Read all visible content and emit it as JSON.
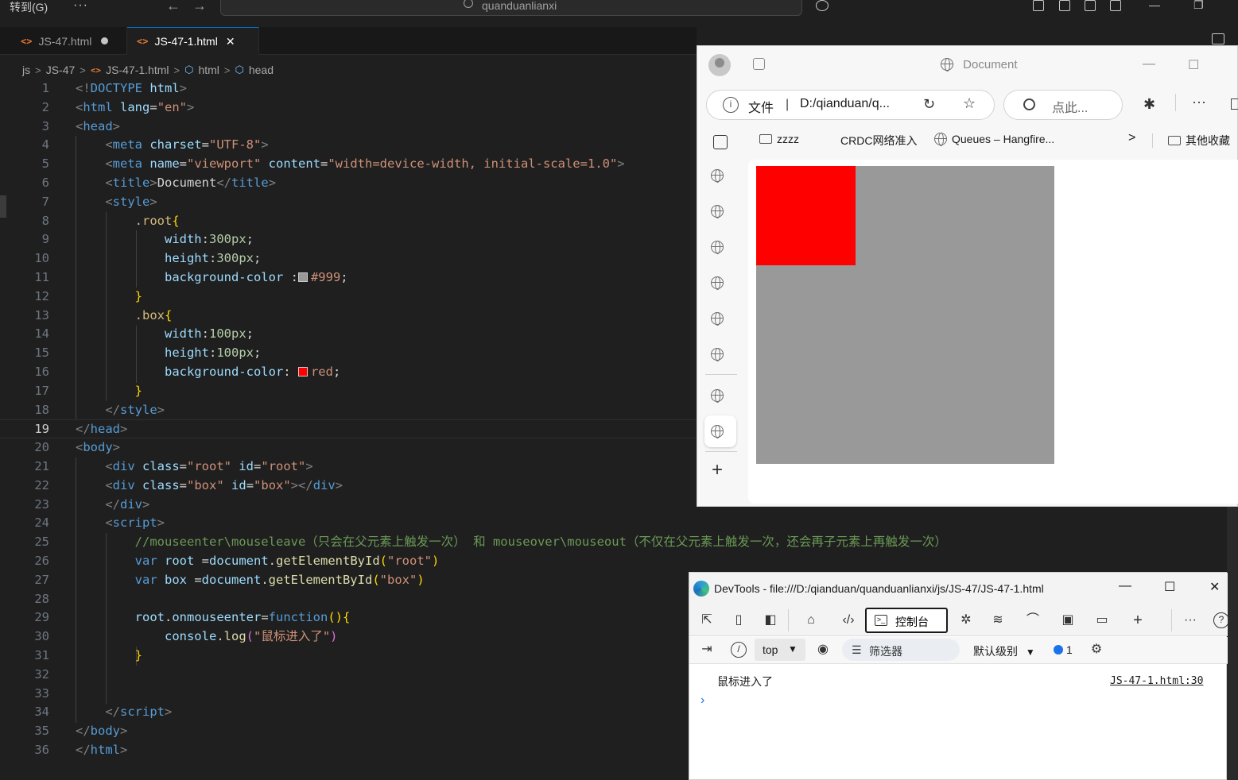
{
  "titlebar": {
    "goto_label": "转到(G)",
    "more_label": "···",
    "back_icon": "←",
    "forward_icon": "→",
    "search_text": "quanduanlianxi",
    "minimize": "—",
    "restore": "❐"
  },
  "tabs": [
    {
      "label": "JS-47.html",
      "icon": "<>",
      "modified": true,
      "active": false
    },
    {
      "label": "JS-47-1.html",
      "icon": "<>",
      "close": "✕",
      "active": true
    }
  ],
  "breadcrumb": {
    "parts": [
      "js",
      "JS-47",
      "JS-47-1.html",
      "html",
      "head"
    ],
    "sep": ">"
  },
  "editor": {
    "current_line": 19,
    "swatch_colors": {
      "gray": "#999999",
      "red": "#ff0000"
    },
    "lines": [
      "1",
      "2",
      "3",
      "4",
      "5",
      "6",
      "7",
      "8",
      "9",
      "10",
      "11",
      "12",
      "13",
      "14",
      "15",
      "16",
      "17",
      "18",
      "19",
      "20",
      "21",
      "22",
      "23",
      "24",
      "25",
      "26",
      "27",
      "28",
      "29",
      "30",
      "31",
      "32",
      "33",
      "34",
      "35",
      "36"
    ],
    "code": {
      "l1a": "<!",
      "l1b": "DOCTYPE",
      "l1c": " html",
      "l1d": ">",
      "l2a": "<",
      "l2b": "html",
      "l2c": " lang",
      "l2d": "=",
      "l2e": "\"en\"",
      "l2f": ">",
      "l3a": "<",
      "l3b": "head",
      "l3c": ">",
      "l4a": "<",
      "l4b": "meta",
      "l4c": " charset",
      "l4d": "=",
      "l4e": "\"UTF-8\"",
      "l4f": ">",
      "l5a": "<",
      "l5b": "meta",
      "l5c": " name",
      "l5d": "=",
      "l5e": "\"viewport\"",
      "l5f": " content",
      "l5g": "=",
      "l5h": "\"width=device-width, initial-scale=1.0\"",
      "l5i": ">",
      "l6a": "<",
      "l6b": "title",
      "l6c": ">",
      "l6d": "Document",
      "l6e": "</",
      "l6f": "title",
      "l6g": ">",
      "l7a": "<",
      "l7b": "style",
      "l7c": ">",
      "l8a": ".root",
      "l8b": "{",
      "l9a": "width",
      "l9b": ":",
      "l9c": "300px",
      "l9d": ";",
      "l10a": "height",
      "l10b": ":",
      "l10c": "300px",
      "l10d": ";",
      "l11a": "background-color",
      "l11b": " :",
      "l11c": "#999",
      "l11d": ";",
      "l12a": "}",
      "l13a": ".box",
      "l13b": "{",
      "l14a": "width",
      "l14b": ":",
      "l14c": "100px",
      "l14d": ";",
      "l15a": "height",
      "l15b": ":",
      "l15c": "100px",
      "l15d": ";",
      "l16a": "background-color",
      "l16b": ": ",
      "l16c": "red",
      "l16d": ";",
      "l17a": "}",
      "l18a": "</",
      "l18b": "style",
      "l18c": ">",
      "l19a": "</",
      "l19b": "head",
      "l19c": ">",
      "l20a": "<",
      "l20b": "body",
      "l20c": ">",
      "l21a": "<",
      "l21b": "div",
      "l21c": " class",
      "l21d": "=",
      "l21e": "\"root\"",
      "l21f": " id",
      "l21g": "=",
      "l21h": "\"root\"",
      "l21i": ">",
      "l22a": "<",
      "l22b": "div",
      "l22c": " class",
      "l22d": "=",
      "l22e": "\"box\"",
      "l22f": " id",
      "l22g": "=",
      "l22h": "\"box\"",
      "l22i": "></",
      "l22j": "div",
      "l22k": ">",
      "l23a": "</",
      "l23b": "div",
      "l23c": ">",
      "l24a": "<",
      "l24b": "script",
      "l24c": ">",
      "l25a": "//mouseenter\\mouseleave（只会在父元素上触发一次） 和 mouseover\\mouseout（不仅在父元素上触发一次，还会再子元素上再触发一次）",
      "l26a": "var",
      "l26b": " root",
      "l26c": " =",
      "l26d": "document",
      "l26e": ".",
      "l26f": "getElementById",
      "l26g": "(",
      "l26h": "\"root\"",
      "l26i": ")",
      "l27a": "var",
      "l27b": " box",
      "l27c": " =",
      "l27d": "document",
      "l27e": ".",
      "l27f": "getElementById",
      "l27g": "(",
      "l27h": "\"box\"",
      "l27i": ")",
      "l29a": "root",
      "l29b": ".",
      "l29c": "onmouseenter",
      "l29d": "=",
      "l29e": "function",
      "l29f": "()",
      "l29g": "{",
      "l30a": "console",
      "l30b": ".",
      "l30c": "log",
      "l30d": "(",
      "l30e": "\"鼠标进入了\"",
      "l30f": ")",
      "l31a": "}",
      "l34a": "</",
      "l34b": "script",
      "l34c": ">",
      "l35a": "</",
      "l35b": "body",
      "l35c": ">",
      "l36a": "</",
      "l36b": "html",
      "l36c": ">"
    }
  },
  "browser": {
    "page_title": "Document",
    "address_label": "文件",
    "address_sep": "|",
    "address_url": "D:/qianduan/q...",
    "search_placeholder": "点此...",
    "bookmarks": [
      "zzzz",
      "CRDC网络准入",
      "Queues – Hangfire...",
      "其他收藏"
    ],
    "bookmark_more": ">",
    "page": {
      "root_color": "#999999",
      "box_color": "#ff0000"
    },
    "minimize": "—",
    "maximize": "☐",
    "add_icon": "+"
  },
  "devtools": {
    "title": "DevTools - file:///D:/qianduan/quanduanlianxi/js/JS-47/JS-47-1.html",
    "console_tab": "控制台",
    "context": "top",
    "filter_placeholder": "筛选器",
    "level": "默认级别",
    "message_count": "1",
    "messages": [
      {
        "text": "鼠标进入了",
        "source": "JS-47-1.html:30"
      }
    ],
    "prompt": "›",
    "minimize": "—",
    "maximize": "☐",
    "close": "✕"
  }
}
